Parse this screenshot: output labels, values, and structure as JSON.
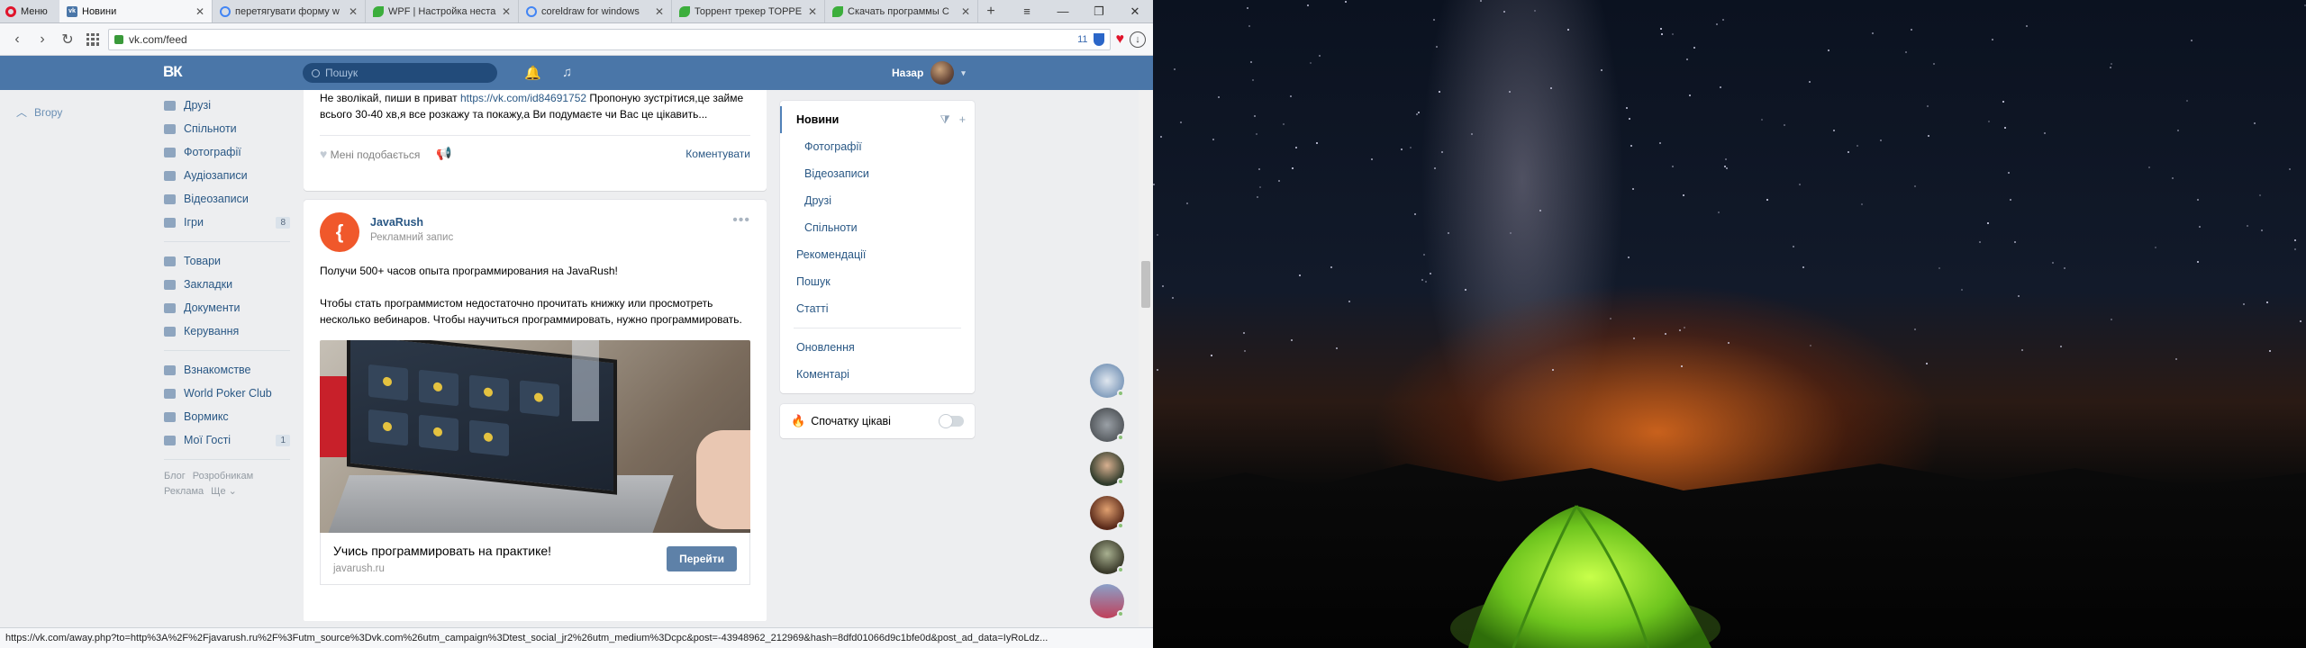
{
  "browser": {
    "menu_label": "Меню",
    "tabs": [
      {
        "title": "Новини",
        "favicon": "vk-icon",
        "active": true
      },
      {
        "title": "перетягувати форму w",
        "favicon": "google-icon"
      },
      {
        "title": "WPF | Настройка неста",
        "favicon": "leaf-icon"
      },
      {
        "title": "coreldraw for windows",
        "favicon": "google-icon"
      },
      {
        "title": "Торрент трекер TOPPE",
        "favicon": "leaf-icon"
      },
      {
        "title": "Скачать программы С",
        "favicon": "leaf-icon"
      }
    ],
    "url": "vk.com/feed",
    "badge_count": "11",
    "status_url": "https://vk.com/away.php?to=http%3A%2F%2Fjavarush.ru%2F%3Futm_source%3Dvk.com%26utm_campaign%3Dtest_social_jr2%26utm_medium%3Dcpc&post=-43948962_212969&hash=8dfd01066d9c1bfe0d&post_ad_data=IyRoLdz..."
  },
  "vk": {
    "logo": "ВК",
    "search_placeholder": "Пошук",
    "user_name": "Назар",
    "up_label": "Вгору",
    "left_menu": [
      {
        "label": "Друзі",
        "icon": "friends-icon"
      },
      {
        "label": "Спільноти",
        "icon": "groups-icon"
      },
      {
        "label": "Фотографії",
        "icon": "camera-icon"
      },
      {
        "label": "Аудіозаписи",
        "icon": "music-icon"
      },
      {
        "label": "Відеозаписи",
        "icon": "video-icon"
      },
      {
        "label": "Ігри",
        "icon": "gamepad-icon",
        "count": "8"
      }
    ],
    "left_menu2": [
      {
        "label": "Товари",
        "icon": "bag-icon"
      },
      {
        "label": "Закладки",
        "icon": "star-icon"
      },
      {
        "label": "Документи",
        "icon": "document-icon"
      },
      {
        "label": "Керування",
        "icon": "manage-icon"
      }
    ],
    "left_menu3": [
      {
        "label": "Взнакомстве",
        "icon": "app-icon"
      },
      {
        "label": "World Poker Club",
        "icon": "app-icon"
      },
      {
        "label": "Вормикс",
        "icon": "app-icon"
      },
      {
        "label": "Мої Гості",
        "icon": "app-icon",
        "count": "1"
      }
    ],
    "footer": [
      "Блог",
      "Розробникам",
      "Реклама",
      "Ще ⌄"
    ]
  },
  "feed": {
    "post1": {
      "text_before": "Не зволікай, пиши в приват ",
      "link": "https://vk.com/id84691752",
      "text_after": " Пропоную зустрітися,це займе всього 30-40 хв,я все розкажу та покажу,а Ви подумаєте чи Вас це цікавить...",
      "like_label": "Мені подобається",
      "comment_label": "Коментувати"
    },
    "post2": {
      "author": "JavaRush",
      "subtitle": "Рекламний запис",
      "para1": "Получи 500+ часов опыта программирования на JavaRush!",
      "para2": "Чтобы стать программистом недостаточно прочитать книжку или просмотреть несколько вебинаров. Чтобы научиться программировать, нужно программировать.",
      "ad_title": "Учись программировать на практике!",
      "ad_domain": "javarush.ru",
      "ad_button": "Перейти"
    }
  },
  "right_filters": {
    "active": "Новини",
    "sub": [
      "Фотографії",
      "Відеозаписи",
      "Друзі",
      "Спільноти"
    ],
    "more": [
      "Рекомендації",
      "Пошук",
      "Статті"
    ],
    "bottom": [
      "Оновлення",
      "Коментарі"
    ],
    "interesting_label": "Спочатку цікаві",
    "interesting_on": false
  },
  "colors": {
    "vk_header": "#4a76a8",
    "link": "#2a5885",
    "opera_red": "#e0142b"
  }
}
